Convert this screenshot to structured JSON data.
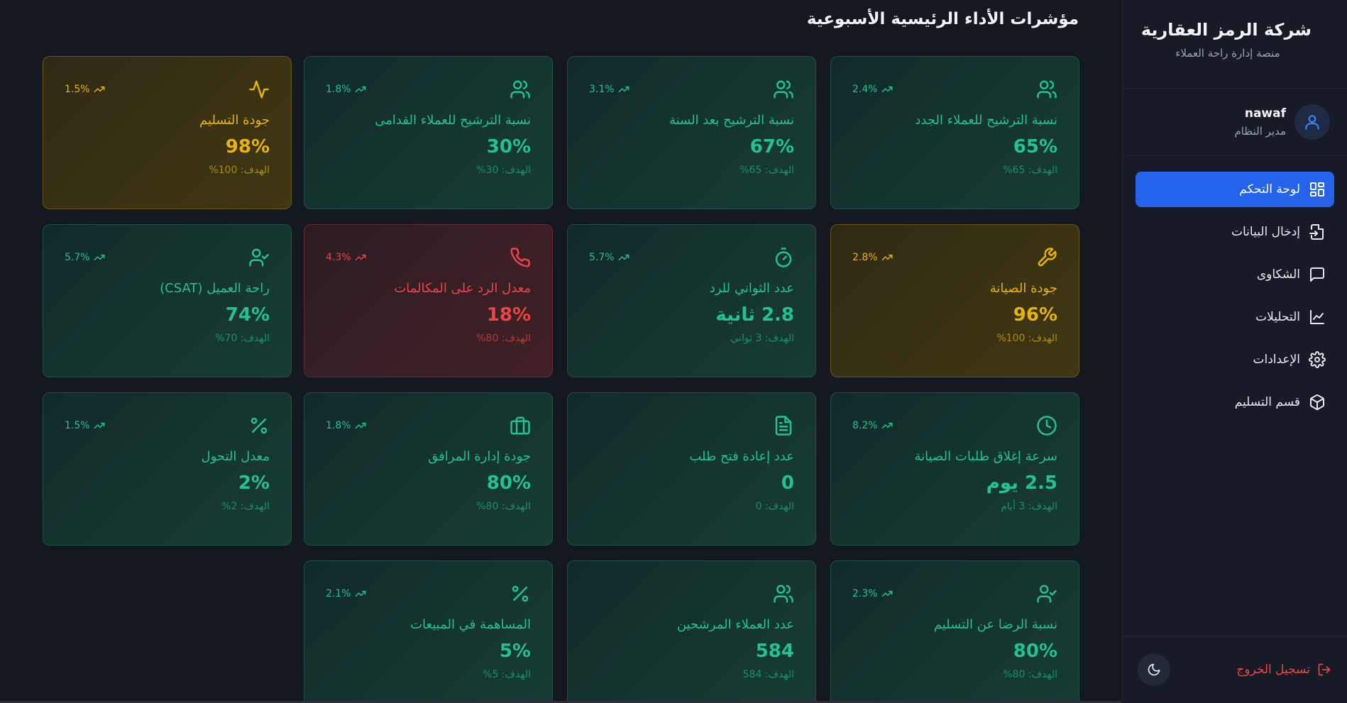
{
  "sidebar": {
    "company": "شركة الرمز العقارية",
    "subtitle": "منصة إدارة راحة العملاء",
    "user": {
      "name": "nawaf",
      "role": "مدير النظام"
    },
    "nav": [
      {
        "label": "لوحة التحكم",
        "icon": "dashboard-icon",
        "active": true
      },
      {
        "label": "إدخال البيانات",
        "icon": "file-input-icon",
        "active": false
      },
      {
        "label": "الشكاوى",
        "icon": "message-icon",
        "active": false
      },
      {
        "label": "التحليلات",
        "icon": "chart-line-icon",
        "active": false
      },
      {
        "label": "الإعدادات",
        "icon": "gear-icon",
        "active": false
      },
      {
        "label": "قسم التسليم",
        "icon": "package-icon",
        "active": false
      }
    ],
    "logout": "تسجيل الخروج"
  },
  "main": {
    "title": "مؤشرات الأداء الرئيسية الأسبوعية"
  },
  "cards": [
    {
      "label": "نسبة الترشيح للعملاء الجدد",
      "value": "65%",
      "target": "الهدف: 65%",
      "trend": "2.4%",
      "icon": "users-icon",
      "status": "green"
    },
    {
      "label": "نسبة الترشيح بعد السنة",
      "value": "67%",
      "target": "الهدف: 65%",
      "trend": "3.1%",
      "icon": "users-icon",
      "status": "green"
    },
    {
      "label": "نسبة الترشيح للعملاء القدامى",
      "value": "30%",
      "target": "الهدف: 30%",
      "trend": "1.8%",
      "icon": "users-icon",
      "status": "green"
    },
    {
      "label": "جودة التسليم",
      "value": "98%",
      "target": "الهدف: 100%",
      "trend": "1.5%",
      "icon": "activity-icon",
      "status": "yellow"
    },
    {
      "label": "جودة الصيانة",
      "value": "96%",
      "target": "الهدف: 100%",
      "trend": "2.8%",
      "icon": "wrench-icon",
      "status": "yellow"
    },
    {
      "label": "عدد الثواني للرد",
      "value": "2.8 ثانية",
      "target": "الهدف: 3 ثواني",
      "trend": "5.7%",
      "icon": "timer-icon",
      "status": "green"
    },
    {
      "label": "معدل الرد على المكالمات",
      "value": "18%",
      "target": "الهدف: 80%",
      "trend": "4.3%",
      "icon": "phone-icon",
      "status": "red"
    },
    {
      "label": "راحة العميل (CSAT)",
      "value": "74%",
      "target": "الهدف: 70%",
      "trend": "5.7%",
      "icon": "user-check-icon",
      "status": "green"
    },
    {
      "label": "سرعة إغلاق طلبات الصيانة",
      "value": "2.5 يوم",
      "target": "الهدف: 3 أيام",
      "trend": "8.2%",
      "icon": "clock-icon",
      "status": "green"
    },
    {
      "label": "عدد إعادة فتح طلب",
      "value": "0",
      "target": "الهدف: 0",
      "trend": "",
      "icon": "document-icon",
      "status": "green"
    },
    {
      "label": "جودة إدارة المرافق",
      "value": "80%",
      "target": "الهدف: 80%",
      "trend": "1.8%",
      "icon": "briefcase-icon",
      "status": "green"
    },
    {
      "label": "معدل التحول",
      "value": "2%",
      "target": "الهدف: 2%",
      "trend": "1.5%",
      "icon": "percent-icon",
      "status": "green"
    },
    {
      "label": "نسبة الرضا عن التسليم",
      "value": "80%",
      "target": "الهدف: 80%",
      "trend": "2.3%",
      "icon": "user-check-icon",
      "status": "green"
    },
    {
      "label": "عدد العملاء المرشحين",
      "value": "584",
      "target": "الهدف: 584",
      "trend": "",
      "icon": "users-icon",
      "status": "green"
    },
    {
      "label": "المساهمة في المبيعات",
      "value": "5%",
      "target": "الهدف: 5%",
      "trend": "2.1%",
      "icon": "percent-icon",
      "status": "green"
    }
  ]
}
